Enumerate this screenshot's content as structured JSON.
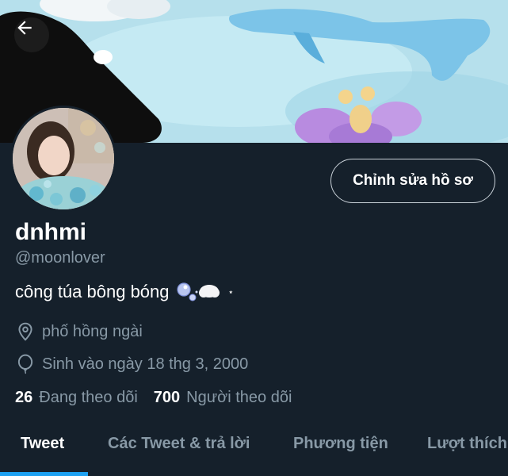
{
  "profile": {
    "name": "dnhmi",
    "handle": "@moonlover",
    "bio": "công túa bông bóng",
    "bio_star": "⋆",
    "location": "phố hồng ngài",
    "birthday": "Sinh vào ngày 18 thg 3, 2000",
    "following_count": "26",
    "following_label": "Đang theo dõi",
    "followers_count": "700",
    "followers_label": "Người theo dõi"
  },
  "actions": {
    "edit_profile": "Chỉnh sửa hồ sơ"
  },
  "tabs": [
    {
      "label": "Tweet"
    },
    {
      "label": "Các Tweet & trả lời"
    },
    {
      "label": "Phương tiện"
    },
    {
      "label": "Lượt thích"
    }
  ],
  "icons": {
    "back": "arrow-left-icon",
    "location": "location-pin-icon",
    "birthday": "balloon-icon",
    "bio_emoji": "bubbles-cloud-emoji"
  },
  "colors": {
    "background": "#15202b",
    "secondary_text": "#8899a6",
    "accent": "#1da1f2"
  }
}
